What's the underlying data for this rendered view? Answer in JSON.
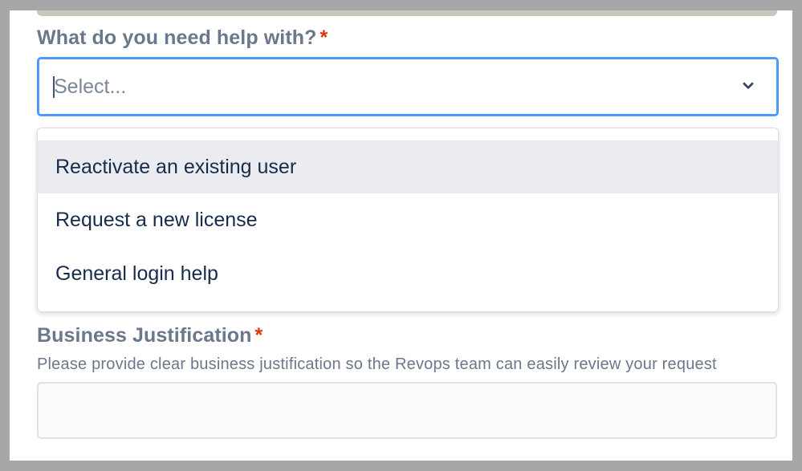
{
  "form": {
    "help_field": {
      "label": "What do you need help with?",
      "required_marker": "*",
      "placeholder": "Select...",
      "expanded": true,
      "options": [
        {
          "label": "Reactivate an existing user",
          "highlighted": true
        },
        {
          "label": "Request a new license",
          "highlighted": false
        },
        {
          "label": "General login help",
          "highlighted": false
        }
      ]
    },
    "justification_field": {
      "label": "Business Justification",
      "required_marker": "*",
      "description": "Please provide clear business justification so the Revops team can easily review your request",
      "value": ""
    }
  },
  "icons": {
    "dropdown": "chevron-down-icon"
  },
  "colors": {
    "focus_border": "#4c9aff",
    "required": "#de350b",
    "label": "#6b778c",
    "option_text": "#172b4d",
    "option_highlight": "#ebecf0"
  }
}
